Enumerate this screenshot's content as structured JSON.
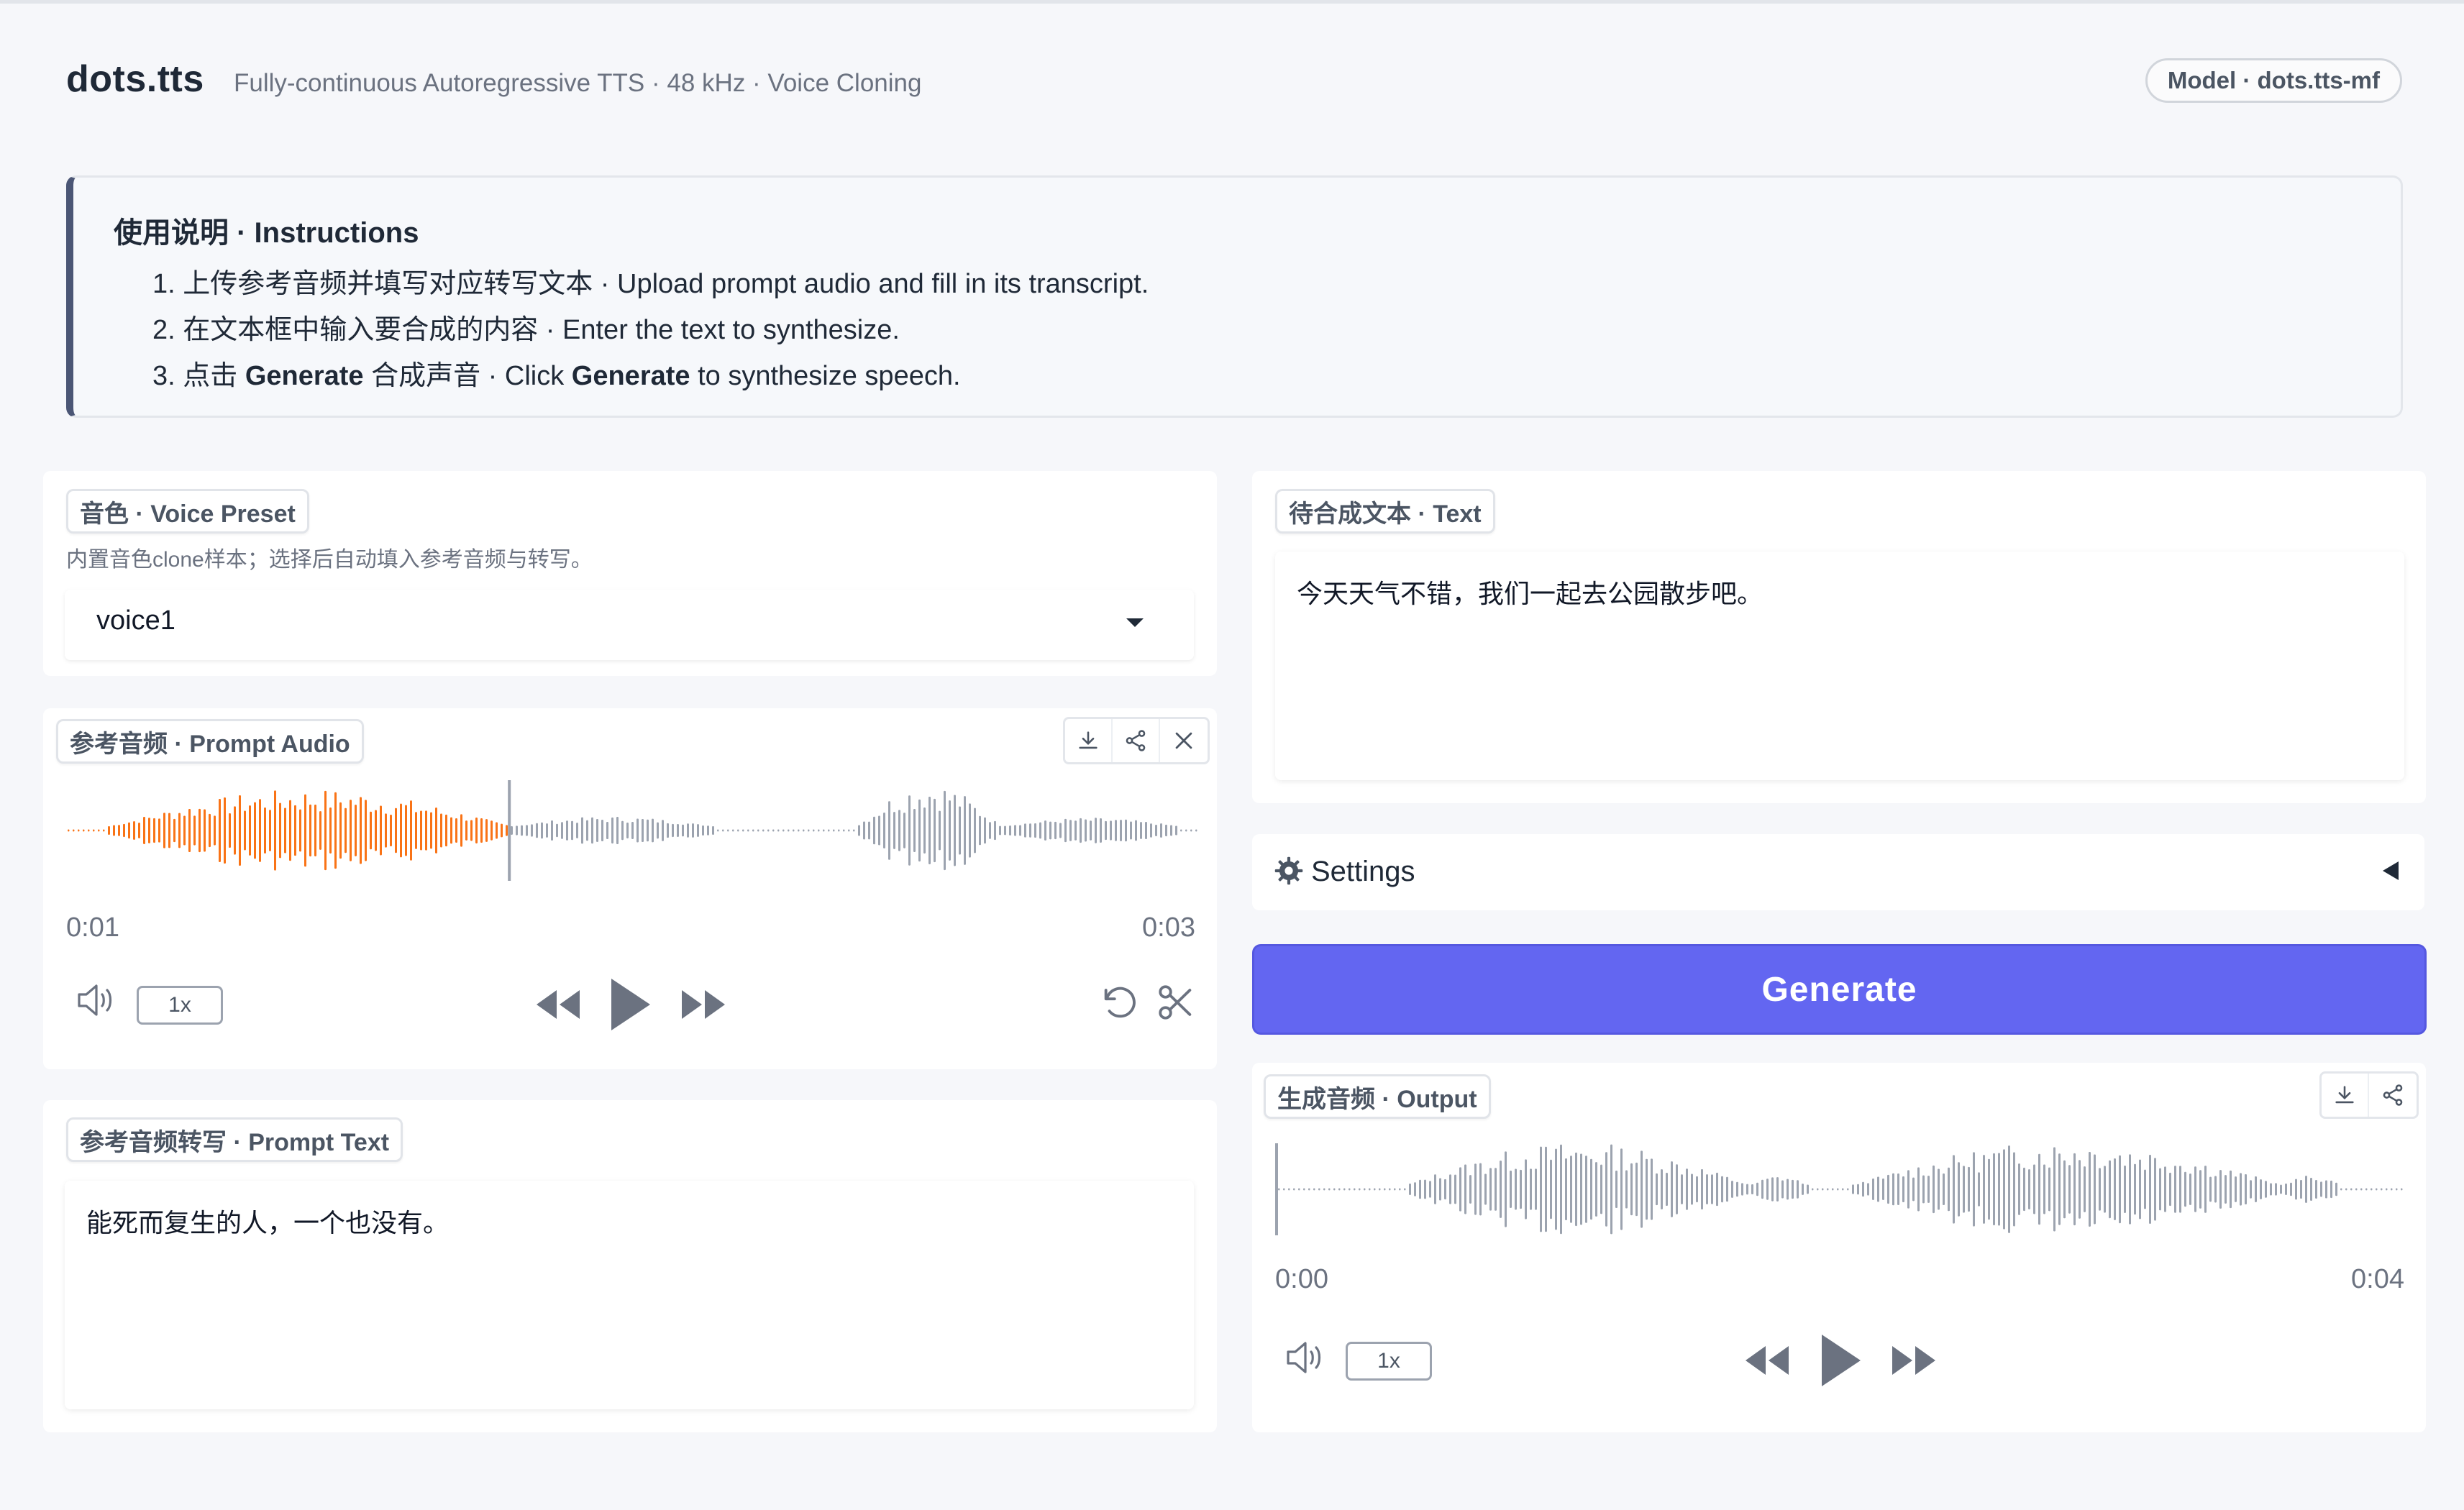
{
  "header": {
    "title": "dots.tts",
    "subtitle": "Fully-continuous Autoregressive TTS · 48 kHz · Voice Cloning",
    "model_badge": "Model · dots.tts-mf"
  },
  "instructions": {
    "title": "使用说明 · Instructions",
    "step1": "1. 上传参考音频并填写对应转写文本 · Upload prompt audio and fill in its transcript.",
    "step2": "2. 在文本框中输入要合成的内容 · Enter the text to synthesize.",
    "step3_prefix": "3. 点击 ",
    "step3_bold1": "Generate",
    "step3_mid": " 合成声音 · Click ",
    "step3_bold2": "Generate",
    "step3_suffix": " to synthesize speech."
  },
  "voice_preset": {
    "label": "音色 · Voice Preset",
    "hint": "内置音色clone样本；选择后自动填入参考音频与转写。",
    "selected": "voice1"
  },
  "prompt_audio": {
    "label": "参考音频 · Prompt Audio",
    "current_time": "0:01",
    "duration": "0:03",
    "rate": "1x",
    "progress": 0.39
  },
  "prompt_text": {
    "label": "参考音频转写 · Prompt Text",
    "value": "能死而复生的人，一个也没有。"
  },
  "text": {
    "label": "待合成文本 · Text",
    "value": "今天天气不错，我们一起去公园散步吧。"
  },
  "settings": {
    "label": "Settings"
  },
  "generate": {
    "label": "Generate"
  },
  "output": {
    "label": "生成音频 · Output",
    "current_time": "0:00",
    "duration": "0:04",
    "rate": "1x",
    "progress": 0.0
  },
  "colors": {
    "accent": "#6366f1",
    "played_wave": "#f97316",
    "unplayed_wave": "#9ca3af"
  }
}
